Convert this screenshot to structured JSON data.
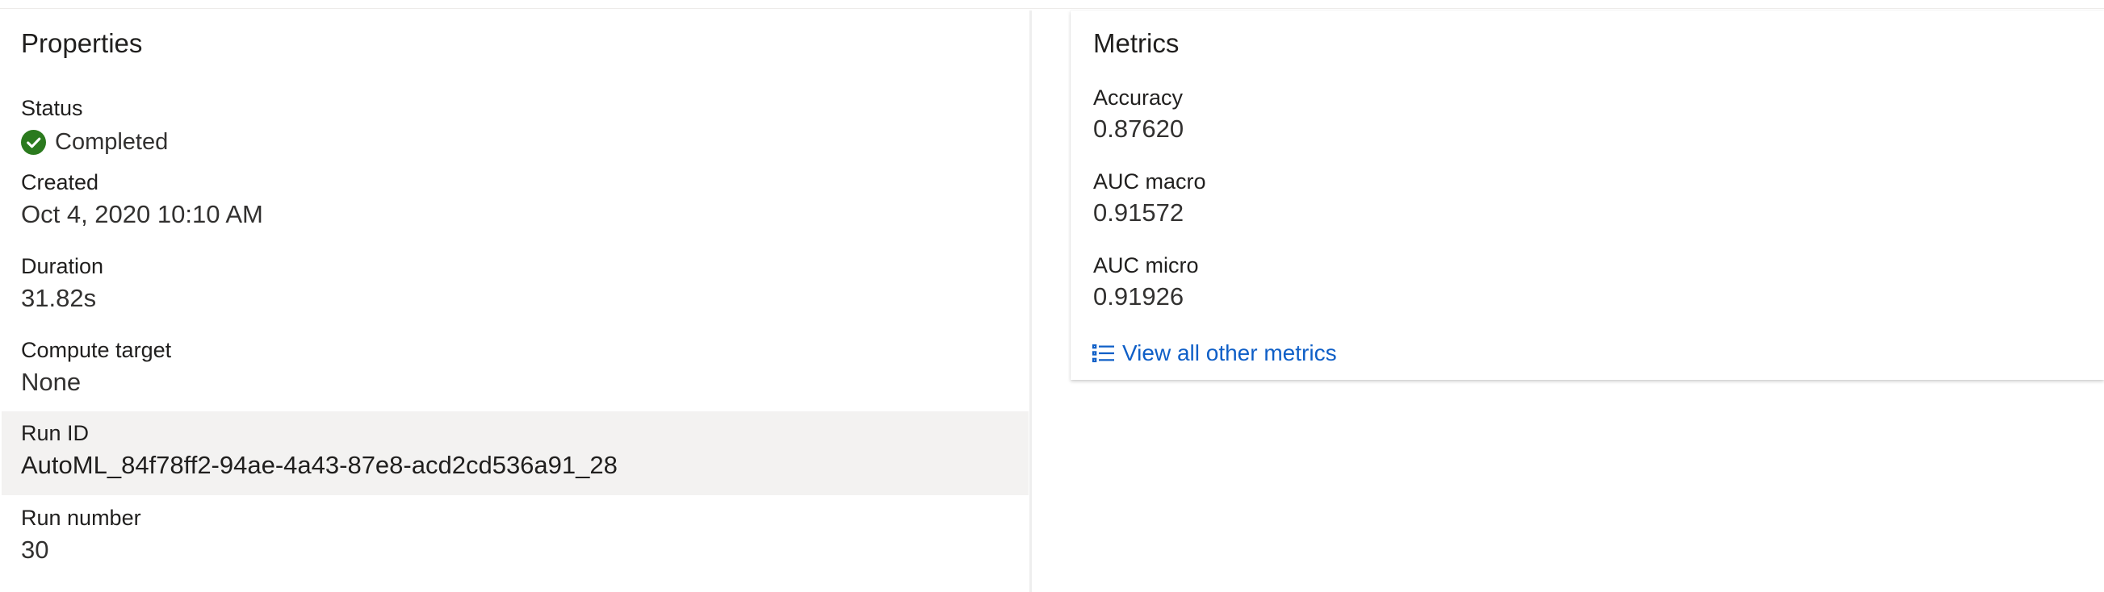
{
  "properties": {
    "title": "Properties",
    "status": {
      "label": "Status",
      "value": "Completed",
      "icon": "check-circle-icon",
      "color": "#107c10"
    },
    "created": {
      "label": "Created",
      "value": "Oct 4, 2020 10:10 AM"
    },
    "duration": {
      "label": "Duration",
      "value": "31.82s"
    },
    "compute_target": {
      "label": "Compute target",
      "value": "None"
    },
    "run_id": {
      "label": "Run ID",
      "value": "AutoML_84f78ff2-94ae-4a43-87e8-acd2cd536a91_28"
    },
    "run_number": {
      "label": "Run number",
      "value": "30"
    }
  },
  "metrics": {
    "title": "Metrics",
    "items": [
      {
        "label": "Accuracy",
        "value": "0.87620"
      },
      {
        "label": "AUC macro",
        "value": "0.91572"
      },
      {
        "label": "AUC micro",
        "value": "0.91926"
      }
    ],
    "view_all_label": "View all other metrics",
    "view_all_icon": "bulleted-list-icon",
    "link_color": "#0f5fc7"
  }
}
